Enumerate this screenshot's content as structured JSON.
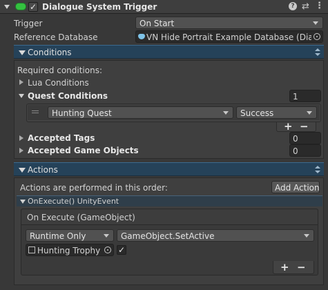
{
  "header": {
    "title": "Dialogue System Trigger",
    "enabled_checked": true
  },
  "trigger": {
    "label": "Trigger",
    "value": "On Start"
  },
  "reference_database": {
    "label": "Reference Database",
    "value": "VN Hide Portrait Example Database (Dialog"
  },
  "conditions": {
    "title": "Conditions",
    "required_label": "Required conditions:",
    "lua_label": "Lua Conditions",
    "quest": {
      "label": "Quest Conditions",
      "count": "1",
      "quest_name": "Hunting Quest",
      "state": "Success"
    },
    "accepted_tags": {
      "label": "Accepted Tags",
      "count": "0"
    },
    "accepted_game_objects": {
      "label": "Accepted Game Objects",
      "count": "0"
    }
  },
  "actions": {
    "title": "Actions",
    "order_label": "Actions are performed in this order:",
    "add_action_label": "Add Action",
    "event": {
      "header": "OnExecute() UnityEvent",
      "list_title": "On Execute (GameObject)",
      "runtime": "Runtime Only",
      "method": "GameObject.SetActive",
      "target": "Hunting Trophy",
      "arg_checked": true
    }
  },
  "list_controls": {
    "plus": "+",
    "minus": "−"
  },
  "colors": {
    "background": "#383838",
    "section_bar": "#254259",
    "field": "#2a2a2a",
    "dropdown": "#515151"
  }
}
